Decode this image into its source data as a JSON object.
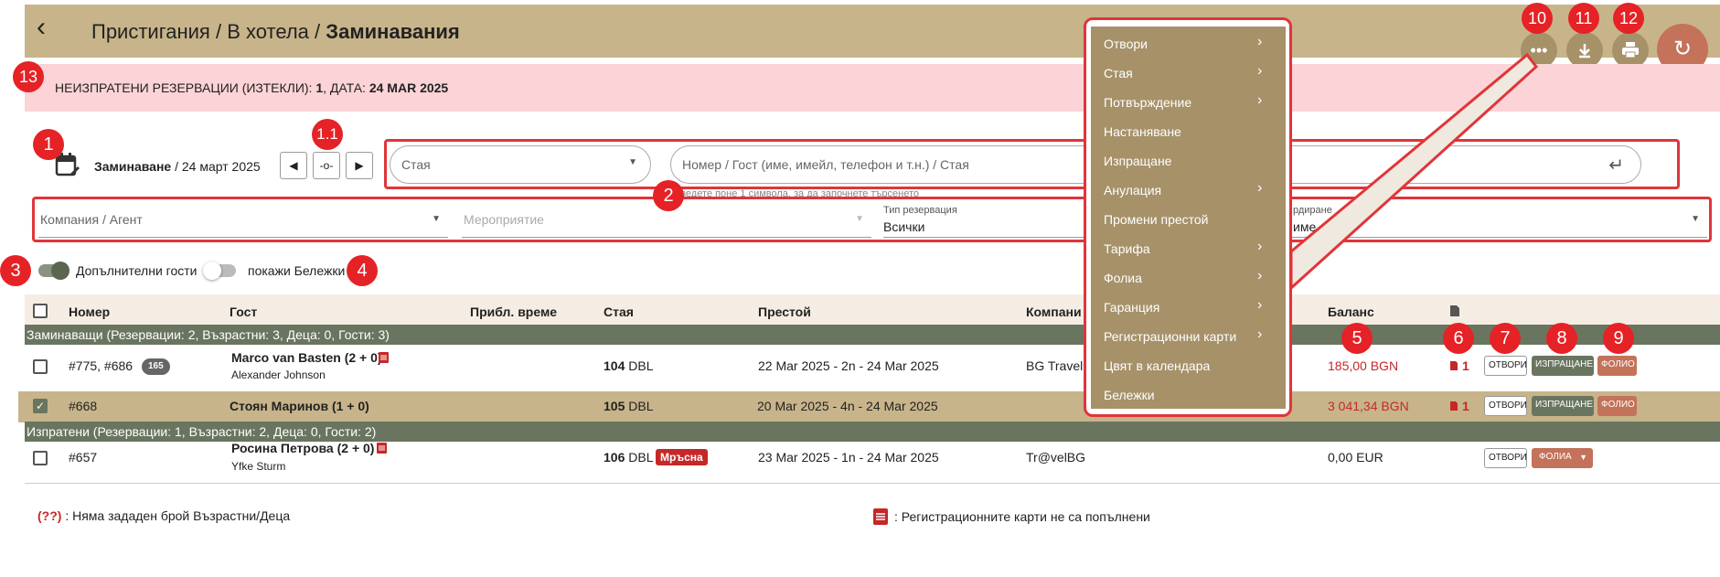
{
  "header": {
    "back_icon": "back-arrow-icon",
    "crumb1": "Пристигания",
    "sep1": "/",
    "crumb2": "В хотела",
    "sep2": "/",
    "crumb3": "Заминавания"
  },
  "alert": {
    "text_prefix": "НЕИЗПРАТЕНИ РЕЗЕРВАЦИИ (ИЗТЕКЛИ): ",
    "count": "1",
    "date_prefix": ", ДАТА: ",
    "date": "24 MAR 2025"
  },
  "filters": {
    "date_label": "Заминаване",
    "date_value": "/ 24 март 2025",
    "room_placeholder": "Стая",
    "search_placeholder": "Номер / Гост (име, имейл, телефон и т.н.) / Стая",
    "search_hint": "Въведете поне 1 символа, за да започнете търсенето",
    "company_placeholder": "Компания / Агент",
    "event_placeholder": "Мероприятие",
    "res_type_label": "Тип резервация",
    "res_type_value": "Всички",
    "sort_label": "рдиране",
    "sort_value": "име"
  },
  "toggles": {
    "extra_guests": "Допълнителни гости",
    "show_notes": "покажи Бележки"
  },
  "table": {
    "headers": [
      "Номер",
      "Гост",
      "Прибл. време",
      "Стая",
      "Престой",
      "Компани",
      "Баланс"
    ],
    "group1": "Заминаващи (Резервации: 2, Възрастни: 3, Деца: 0, Гости: 3)",
    "group2": "Изпратени (Резервации: 1, Възрастни: 2, Деца: 0, Гости: 2)",
    "rows": [
      {
        "number": "#775, #686",
        "tag": "165",
        "guest": "Marco van Basten (2 + 0)",
        "guest2": "Alexander Johnson",
        "room": "104",
        "room_type": "DBL",
        "stay": "22 Mar 2025 - 2n - 24 Mar 2025",
        "company": "BG Travel",
        "balance": "185,00 BGN",
        "docs": "1"
      },
      {
        "number": "#668",
        "guest": "Стоян Маринов (1 + 0)",
        "room": "105",
        "room_type": "DBL",
        "stay": "20 Mar 2025 - 4n - 24 Mar 2025",
        "balance": "3 041,34 BGN",
        "docs": "1"
      },
      {
        "number": "#657",
        "guest": "Росина Петрова (2 + 0)",
        "guest2": "Yfke Sturm",
        "room": "106",
        "room_type": "DBL",
        "room_status": "Мръсна",
        "stay": "23 Mar 2025 - 1n - 24 Mar 2025",
        "company": "Tr@velBG",
        "balance": "0,00 EUR"
      }
    ],
    "btn_open": "ОТВОРИ",
    "btn_checkout": "ИЗПРАЩАНЕ",
    "btn_folio": "ФОЛИО",
    "btn_folios": "ФОЛИА"
  },
  "legend": {
    "missing": "(??)",
    "missing_text": " : Няма зададен брой Възрастни/Деца",
    "reg_text": ": Регистрационните карти не са попълнени"
  },
  "menu": {
    "items": [
      {
        "label": "Отвори",
        "arrow": "›"
      },
      {
        "label": "Стая",
        "arrow": "›"
      },
      {
        "label": "Потвърждение",
        "arrow": "›"
      },
      {
        "label": "Настаняване",
        "arrow": ""
      },
      {
        "label": "Изпращане",
        "arrow": ""
      },
      {
        "label": "Анулация",
        "arrow": "›"
      },
      {
        "label": "Промени престой",
        "arrow": ""
      },
      {
        "label": "Тарифа",
        "arrow": "›"
      },
      {
        "label": "Фолиа",
        "arrow": "›"
      },
      {
        "label": "Гаранция",
        "arrow": "›"
      },
      {
        "label": "Регистрационни карти",
        "arrow": "›"
      },
      {
        "label": "Цвят в календара",
        "arrow": ""
      },
      {
        "label": "Бележки",
        "arrow": ""
      }
    ]
  },
  "annotations": [
    "1",
    "1.1",
    "2",
    "3",
    "4",
    "5",
    "6",
    "7",
    "8",
    "9",
    "10",
    "11",
    "12",
    "13"
  ],
  "colors": {
    "header": "#c8b48a",
    "alert": "#fcd3d6",
    "group": "#6a7560",
    "accent": "#e52226",
    "menu": "#a69169",
    "refresh": "#c4725a"
  }
}
